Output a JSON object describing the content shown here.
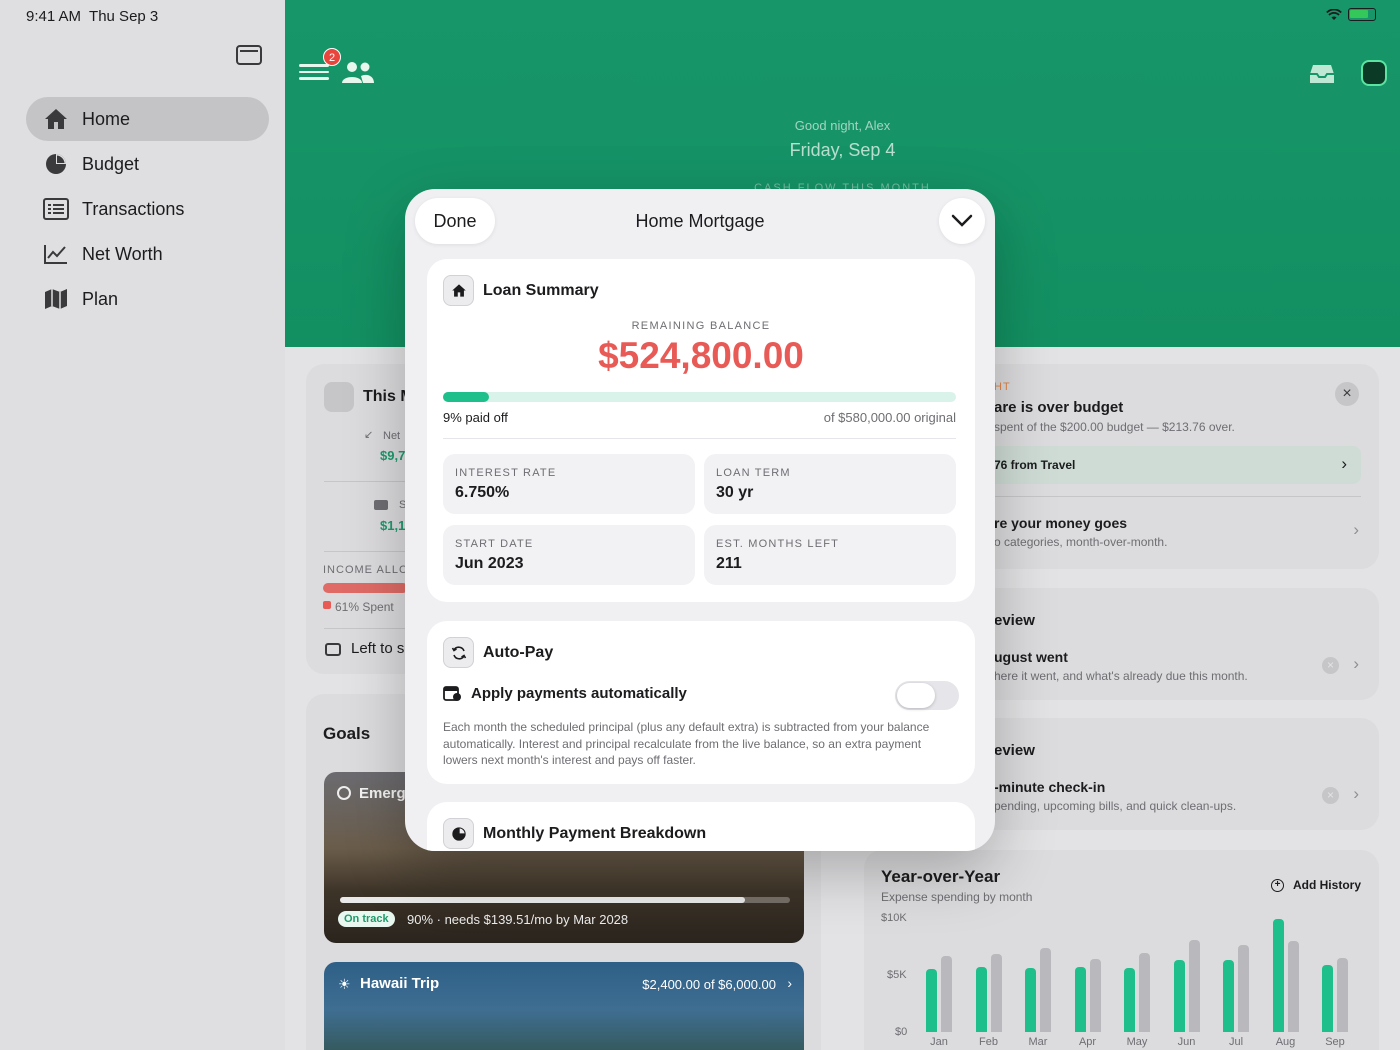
{
  "status": {
    "time": "9:41 AM",
    "date": "Thu Sep 3"
  },
  "sidebar": {
    "items": [
      {
        "label": "Home",
        "icon": "house-icon",
        "active": true
      },
      {
        "label": "Budget",
        "icon": "pie-chart-icon",
        "active": false
      },
      {
        "label": "Transactions",
        "icon": "list-icon",
        "active": false
      },
      {
        "label": "Net Worth",
        "icon": "line-chart-icon",
        "active": false
      },
      {
        "label": "Plan",
        "icon": "map-icon",
        "active": false
      }
    ]
  },
  "header": {
    "badge_count": "2",
    "greeting": "Good night, Alex",
    "date": "Friday, Sep 4",
    "cashflow_label": "CASH FLOW THIS MONTH",
    "accent": "#17966a"
  },
  "this_month": {
    "title": "This M",
    "net_label": "Net",
    "net_value": "$9,7",
    "second_label": "S",
    "second_value": "$1,1",
    "income_label": "INCOME ALLC",
    "spent_label": "61% Spent",
    "spent_fraction": 0.61,
    "left_label": "Left to s"
  },
  "goals": {
    "title": "Goals",
    "items": [
      {
        "name": "Emerg",
        "status": "On track",
        "detail": "90% · needs $139.51/mo by Mar 2028",
        "progress": 0.9
      },
      {
        "name": "Hawaii Trip",
        "amount": "$2,400.00 of $6,000.00"
      }
    ]
  },
  "insight": {
    "tag": "HT",
    "title": "are is over budget",
    "sub": "spent of the $200.00 budget — $213.76 over.",
    "pill": "76 from Travel",
    "row_title": "re your money goes",
    "row_sub": "o categories, month-over-month."
  },
  "review1": {
    "heading": "eview",
    "title": "ugust went",
    "sub": "here it went, and what's already due this month."
  },
  "review2": {
    "heading": "eview",
    "title": "-minute check-in",
    "sub": "pending, upcoming bills, and quick clean-ups."
  },
  "yoy": {
    "title": "Year-over-Year",
    "subtitle": "Expense spending by month",
    "action": "Add History",
    "y_ticks": [
      "$10K",
      "$5K",
      "$0"
    ]
  },
  "chart_data": {
    "type": "bar",
    "title": "Year-over-Year",
    "subtitle": "Expense spending by month",
    "categories": [
      "Jan",
      "Feb",
      "Mar",
      "Apr",
      "May",
      "Jun",
      "Jul",
      "Aug",
      "Sep"
    ],
    "series": [
      {
        "values": [
          5500,
          5700,
          5600,
          5700,
          5600,
          6300,
          6300,
          9900,
          5900
        ]
      },
      {
        "values": [
          6700,
          6800,
          7400,
          6400,
          6900,
          8100,
          7600,
          8000,
          6500
        ]
      }
    ],
    "ylim": [
      0,
      10000
    ],
    "colors": [
      "#1fbf8b",
      "#b9b9bd"
    ]
  },
  "modal": {
    "done_label": "Done",
    "title": "Home Mortgage",
    "loan_summary": {
      "heading": "Loan Summary",
      "remaining_label": "REMAINING BALANCE",
      "remaining_value": "$524,800.00",
      "paid_fraction": 0.09,
      "paid_label": "9% paid off",
      "original_label": "of $580,000.00 original",
      "tiles": [
        {
          "label": "INTEREST RATE",
          "value": "6.750%"
        },
        {
          "label": "LOAN TERM",
          "value": "30 yr"
        },
        {
          "label": "START DATE",
          "value": "Jun 2023"
        },
        {
          "label": "EST. MONTHS LEFT",
          "value": "211"
        }
      ]
    },
    "autopay": {
      "heading": "Auto-Pay",
      "toggle_label": "Apply payments automatically",
      "enabled": false,
      "description": "Each month the scheduled principal (plus any default extra) is subtracted from your balance automatically. Interest and principal recalculate from the live balance, so an extra payment lowers next month's interest and pays off faster."
    },
    "breakdown": {
      "heading": "Monthly Payment Breakdown"
    },
    "accent_red": "#e85a55",
    "accent_green": "#1fbf8b"
  }
}
